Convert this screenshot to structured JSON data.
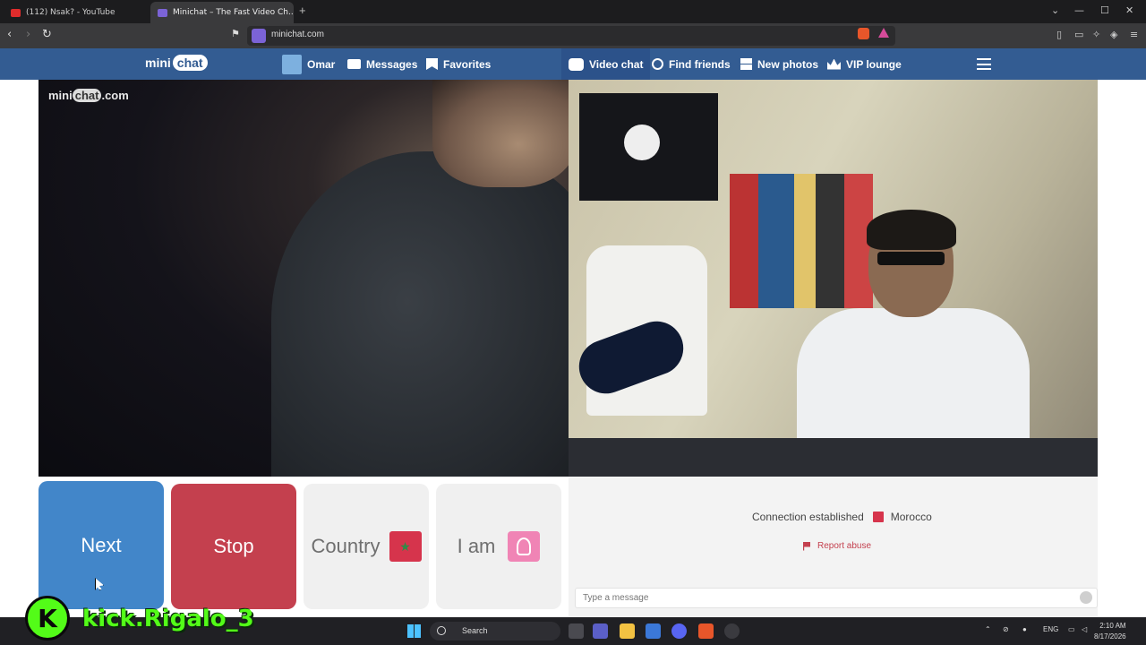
{
  "browser": {
    "tabs": [
      {
        "title": "(112) Nsak? - YouTube",
        "favicon_color": "#e02c2c"
      },
      {
        "title": "Minichat – The Fast Video Ch...",
        "favicon_color": "#7b63d6"
      }
    ],
    "url": "minichat.com"
  },
  "site": {
    "logo_mini": "mini",
    "logo_chat": "chat",
    "nav": {
      "user": "Omar",
      "messages": "Messages",
      "favorites": "Favorites",
      "video_chat": "Video chat",
      "find_friends": "Find friends",
      "new_photos": "New photos",
      "vip_lounge": "VIP lounge"
    },
    "watermark": {
      "pre": "mini",
      "chat": "chat",
      "post": ".com"
    }
  },
  "controls": {
    "next": "Next",
    "stop": "Stop",
    "country": "Country",
    "country_flag": "★",
    "iam": "I am"
  },
  "chat": {
    "status": "Connection established",
    "country": "Morocco",
    "report": "Report abuse",
    "placeholder": "Type a message"
  },
  "overlay": {
    "kick_letter": "K",
    "handle": "kick.Rigalo_3"
  },
  "taskbar": {
    "search": "Search",
    "lang": "ENG",
    "time": "2:10 AM",
    "date": "8/17/2026"
  },
  "colors": {
    "navbar": "#335c92",
    "next": "#4286c9",
    "stop": "#c4404e",
    "kick_green": "#53fc18"
  }
}
